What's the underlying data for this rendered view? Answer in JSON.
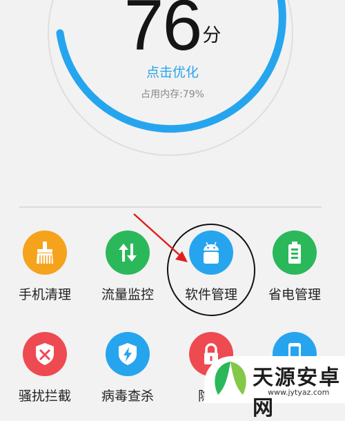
{
  "score": {
    "value": "76",
    "unit": "分"
  },
  "optimize_label": "点击优化",
  "memory_label": "占用内存:79%",
  "grid": {
    "row1": [
      {
        "label": "手机清理",
        "icon": "broom-icon",
        "color": "#f5a21c"
      },
      {
        "label": "流量监控",
        "icon": "up-down-arrows-icon",
        "color": "#2bb85a"
      },
      {
        "label": "软件管理",
        "icon": "android-icon",
        "color": "#26a5ee"
      },
      {
        "label": "省电管理",
        "icon": "battery-icon",
        "color": "#2bb85a"
      }
    ],
    "row2": [
      {
        "label": "骚扰拦截",
        "icon": "shield-block-icon",
        "color": "#ee4a52"
      },
      {
        "label": "病毒查杀",
        "icon": "shield-lightning-icon",
        "color": "#26a5ee"
      },
      {
        "label": "隐私",
        "icon": "lock-icon",
        "color": "#ee4a52"
      },
      {
        "label": "",
        "icon": "phone-icon",
        "color": "#26a5ee"
      }
    ]
  },
  "watermark": {
    "title": "天源安卓网",
    "url": "www.jytyaz.com"
  }
}
